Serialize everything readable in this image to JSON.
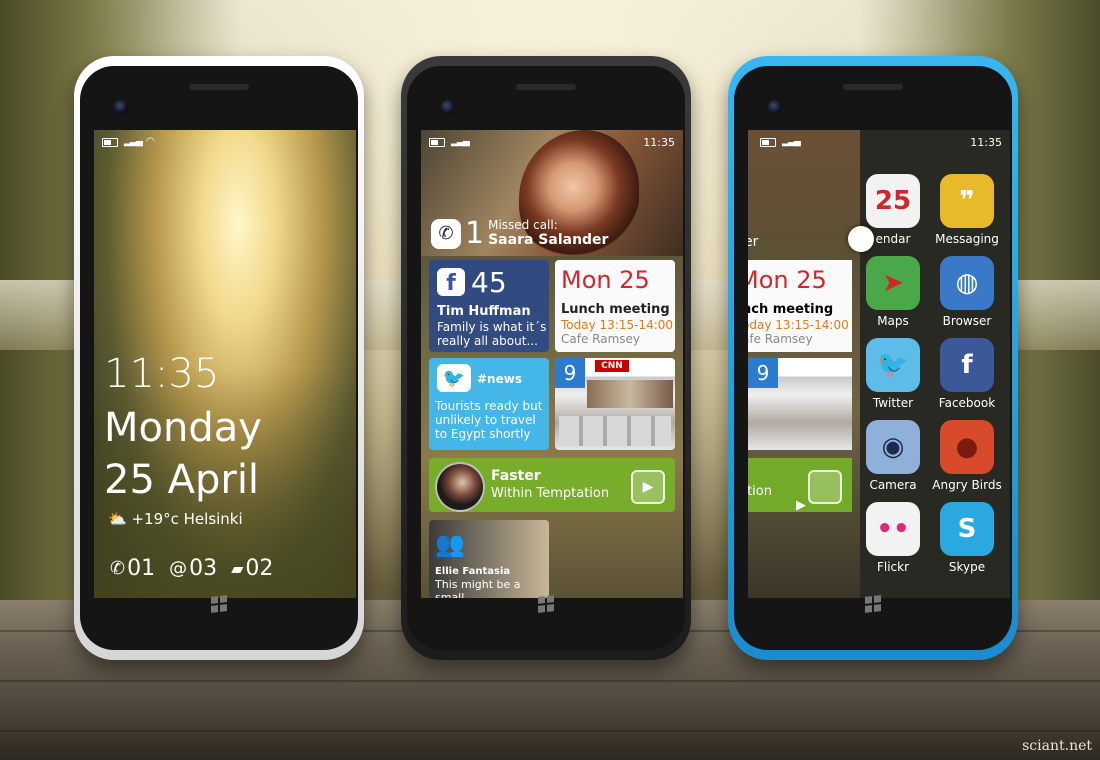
{
  "phone1": {
    "time": "11:35",
    "day": "Monday",
    "date": "25 April",
    "weather": "+19°c Helsinki",
    "calls": "01",
    "mentions": "03",
    "messages": "02"
  },
  "phone2": {
    "status_time": "11:35",
    "missed_count": "1",
    "missed_label": "Missed call:",
    "missed_name": "Saara Salander",
    "facebook": {
      "count": "45",
      "name": "Tim  Huffman",
      "message": "Family is what it´s really all about..."
    },
    "calendar": {
      "date_day": "Mon",
      "date_num": "25",
      "title": "Lunch meeting",
      "time": "Today 13:15-14:00",
      "place": "Cafe Ramsey"
    },
    "twitter": {
      "tag": "#news",
      "message": "Tourists ready but unlikely to travel to Egypt shortly"
    },
    "news": {
      "badge": "9",
      "logo": "CNN"
    },
    "music": {
      "title": "Faster",
      "subtitle": "Within Temptation"
    },
    "people": {
      "name": "Ellie Fantasia",
      "message": "This might be a small"
    }
  },
  "phone3": {
    "status_time": "11:35",
    "peek": {
      "date_day": "Mon",
      "date_num": "25",
      "title": "nch meeting",
      "time": "oday 13:15-14:00",
      "place": "afe Ramsey",
      "badge": "9",
      "music": "tation",
      "hero": "er"
    },
    "apps": [
      {
        "label": "endar",
        "glyph": "25",
        "color": "#f2f2f2",
        "fg": "#d0272c"
      },
      {
        "label": "Messaging",
        "glyph": "❞",
        "color": "#e8b92a",
        "fg": "#fff"
      },
      {
        "label": "Maps",
        "glyph": "➤",
        "color": "#4aa84a",
        "fg": "#d0272c"
      },
      {
        "label": "Browser",
        "glyph": "◍",
        "color": "#3a78c8",
        "fg": "#fff"
      },
      {
        "label": "Twitter",
        "glyph": "🐦",
        "color": "#5dbde8",
        "fg": "#fff"
      },
      {
        "label": "Facebook",
        "glyph": "f",
        "color": "#3b5998",
        "fg": "#fff"
      },
      {
        "label": "Camera",
        "glyph": "◉",
        "color": "#8fb0d8",
        "fg": "#1a2a4a"
      },
      {
        "label": "Angry Birds",
        "glyph": "●",
        "color": "#d84a2a",
        "fg": "#7a1a10"
      },
      {
        "label": "Flickr",
        "glyph": "••",
        "color": "#f2f2f2",
        "fg": "#e0287a"
      },
      {
        "label": "Skype",
        "glyph": "S",
        "color": "#2aa8e0",
        "fg": "#fff"
      }
    ]
  },
  "credit": "sciant.net"
}
